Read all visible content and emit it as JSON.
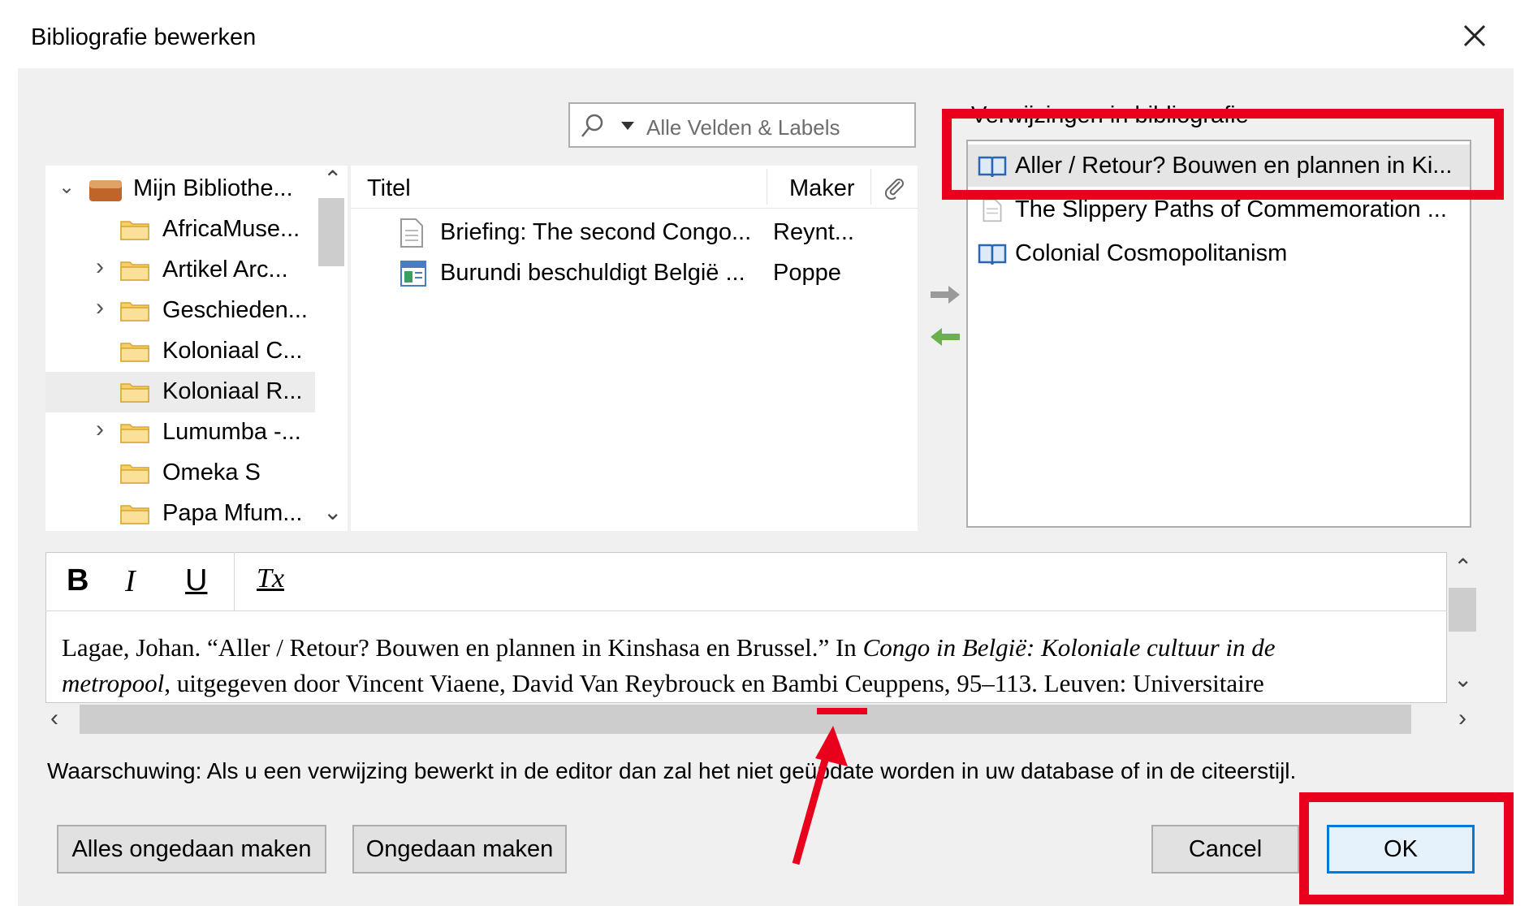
{
  "dialog": {
    "title": "Bibliografie bewerken"
  },
  "search": {
    "placeholder": "Alle Velden & Labels"
  },
  "collections": {
    "root": "Mijn Bibliothe...",
    "items": [
      {
        "label": "AfricaMuse...",
        "expandable": false,
        "selected": false
      },
      {
        "label": "Artikel Arc...",
        "expandable": true,
        "selected": false
      },
      {
        "label": "Geschieden...",
        "expandable": true,
        "selected": false
      },
      {
        "label": "Koloniaal C...",
        "expandable": false,
        "selected": false
      },
      {
        "label": "Koloniaal R...",
        "expandable": false,
        "selected": true
      },
      {
        "label": "Lumumba -...",
        "expandable": true,
        "selected": false
      },
      {
        "label": "Omeka S",
        "expandable": false,
        "selected": false
      },
      {
        "label": "Papa Mfum...",
        "expandable": false,
        "selected": false
      }
    ]
  },
  "items_table": {
    "columns": {
      "title": "Titel",
      "creator": "Maker"
    },
    "rows": [
      {
        "title": "Briefing: The second Congo...",
        "creator": "Reynt...",
        "icon": "document-icon"
      },
      {
        "title": "Burundi beschuldigt België ...",
        "creator": "Poppe",
        "icon": "newspaper-icon"
      }
    ]
  },
  "bibliography": {
    "label": "Verwijzingen in bibliografie",
    "items": [
      {
        "title": "Aller / Retour? Bouwen en plannen in Ki...",
        "icon": "book-icon",
        "selected": true
      },
      {
        "title": "The Slippery Paths of Commemoration ...",
        "icon": "document-icon",
        "selected": false
      },
      {
        "title": "Colonial Cosmopolitanism",
        "icon": "book-icon",
        "selected": false
      }
    ]
  },
  "editor": {
    "bold": "B",
    "italic": "I",
    "underline": "U",
    "clear": "Tx",
    "line1_a": "Lagae, Johan. “Aller / Retour? Bouwen en plannen in Kinshasa en Brussel.” In ",
    "line1_b": "Congo in België: Koloniale cultuur in de",
    "line2_a": "metropool",
    "line2_b": ", uitgegeven door Vincent Viaene, David Van Reybrouck en Bambi Ceuppens, 95–113. Leuven: Universitaire"
  },
  "warning": "Waarschuwing: Als u een verwijzing bewerkt in de editor dan zal het niet geüpdate worden in uw database of in de citeerstijl.",
  "buttons": {
    "revert_all": "Alles ongedaan maken",
    "revert": "Ongedaan maken",
    "cancel": "Cancel",
    "ok": "OK"
  },
  "colors": {
    "annotation": "#e8001c",
    "annotation_arrow": "#e8001c",
    "focus": "#0078d7"
  }
}
